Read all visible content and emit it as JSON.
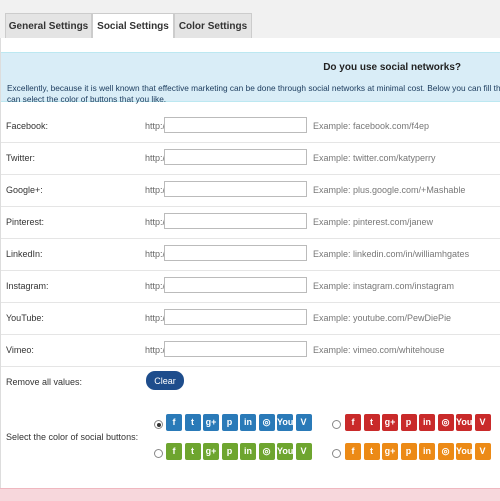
{
  "tabs": [
    {
      "label": "General Settings"
    },
    {
      "label": "Social Settings"
    },
    {
      "label": "Color Settings"
    }
  ],
  "intro": {
    "question": "Do you use social networks?",
    "text_line1": "Excellently, because it is well known that effective marketing can be done through social networks at minimal cost. Below you can fill the links to",
    "text_line2": "can select the color of buttons that you like."
  },
  "url_prefix": "http://",
  "networks": [
    {
      "label": "Facebook:",
      "value": "",
      "hint": "Example: facebook.com/f4ep",
      "icon": "facebook-icon"
    },
    {
      "label": "Twitter:",
      "value": "",
      "hint": "Example: twitter.com/katyperry",
      "icon": "twitter-icon"
    },
    {
      "label": "Google+:",
      "value": "",
      "hint": "Example: plus.google.com/+Mashable",
      "icon": "google-plus-icon"
    },
    {
      "label": "Pinterest:",
      "value": "",
      "hint": "Example: pinterest.com/janew",
      "icon": "pinterest-icon"
    },
    {
      "label": "LinkedIn:",
      "value": "",
      "hint": "Example: linkedin.com/in/williamhgates",
      "icon": "linkedin-icon"
    },
    {
      "label": "Instagram:",
      "value": "",
      "hint": "Example: instagram.com/instagram",
      "icon": "instagram-icon"
    },
    {
      "label": "YouTube:",
      "value": "",
      "hint": "Example: youtube.com/PewDiePie",
      "icon": "youtube-icon"
    },
    {
      "label": "Vimeo:",
      "value": "",
      "hint": "Example: vimeo.com/whitehouse",
      "icon": "vimeo-icon"
    }
  ],
  "remove": {
    "label": "Remove all values:",
    "button": "Clear"
  },
  "colors": {
    "label": "Select the color of social buttons:",
    "glyphs": [
      "f",
      "t",
      "g+",
      "p",
      "in",
      "◎",
      "You",
      "V"
    ],
    "options": [
      {
        "name": "blue",
        "color": "#2a7ab8",
        "selected": true
      },
      {
        "name": "red",
        "color": "#c92a2a",
        "selected": false
      },
      {
        "name": "green",
        "color": "#6ea52f",
        "selected": false
      },
      {
        "name": "orange",
        "color": "#ec8a16",
        "selected": false
      }
    ]
  }
}
